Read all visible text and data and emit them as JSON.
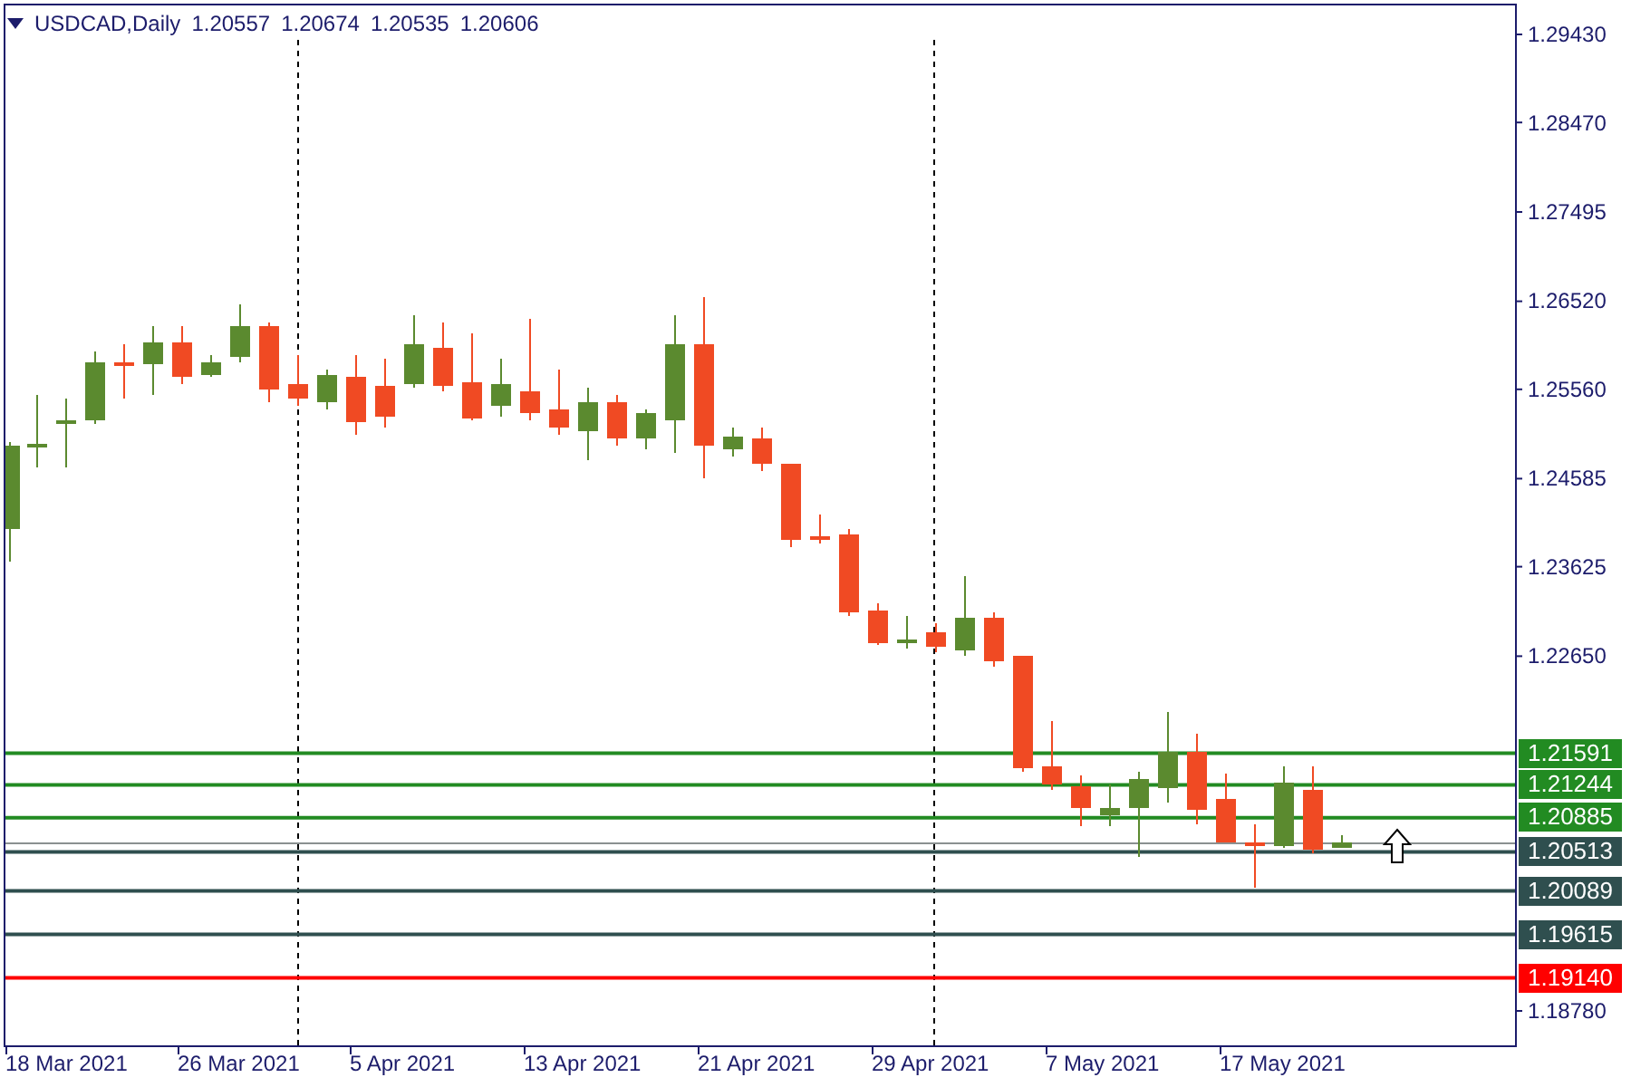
{
  "header": {
    "symbol": "USDCAD,Daily",
    "ohlc": [
      "1.20557",
      "1.20674",
      "1.20535",
      "1.20606"
    ]
  },
  "price_axis": {
    "ticks": [
      "1.29430",
      "1.28470",
      "1.27495",
      "1.26520",
      "1.25560",
      "1.24585",
      "1.23625",
      "1.22650",
      "1.18780"
    ]
  },
  "levels": [
    {
      "label": "1.21591",
      "color": "#228b22"
    },
    {
      "label": "1.21244",
      "color": "#228b22"
    },
    {
      "label": "1.20885",
      "color": "#228b22"
    },
    {
      "label": "1.20513",
      "color": "#2f4f4f"
    },
    {
      "label": "1.20089",
      "color": "#2f4f4f"
    },
    {
      "label": "1.19615",
      "color": "#2f4f4f"
    },
    {
      "label": "1.19140",
      "color": "#ff0000"
    }
  ],
  "time_axis": {
    "labels": [
      "18 Mar 2021",
      "26 Mar 2021",
      "5 Apr 2021",
      "13 Apr 2021",
      "21 Apr 2021",
      "29 Apr 2021",
      "7 May 2021",
      "17 May 2021"
    ]
  }
}
